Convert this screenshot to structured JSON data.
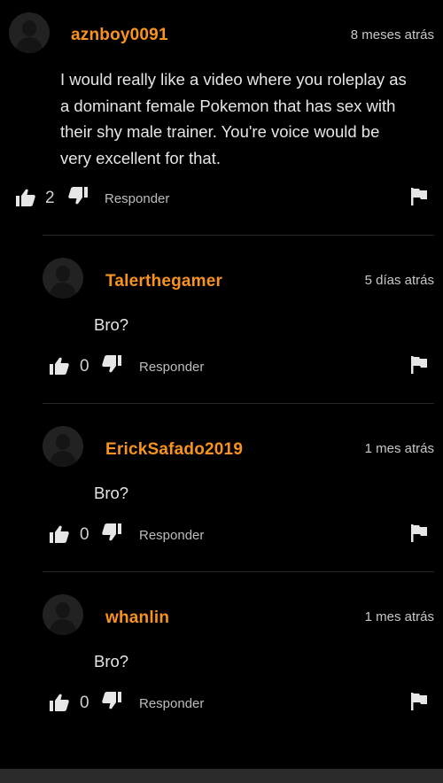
{
  "comments": [
    {
      "username": "aznboy0091",
      "time": "8 meses atrás",
      "lines": [
        "I would really like a video where you roleplay as",
        "a dominant female Pokemon that has sex with",
        "their shy male trainer. You're voice would be",
        "very excellent for that."
      ],
      "likes": "2",
      "reply_label": "Responder"
    },
    {
      "username": "Talerthegamer",
      "time": "5 días atrás",
      "lines": [
        "Bro?"
      ],
      "likes": "0",
      "reply_label": "Responder"
    },
    {
      "username": "ErickSafado2019",
      "time": "1 mes atrás",
      "lines": [
        "Bro?"
      ],
      "likes": "0",
      "reply_label": "Responder"
    },
    {
      "username": "whanlin",
      "time": "1 mes atrás",
      "lines": [
        "Bro?"
      ],
      "likes": "0",
      "reply_label": "Responder"
    }
  ],
  "bottom_bar": {
    "text": ""
  },
  "colors": {
    "background": "#000000",
    "username": "#f7931e",
    "text": "#e6e6e6",
    "muted": "#bcbcbc"
  },
  "icons": [
    "avatar-placeholder",
    "thumbs-up-icon",
    "thumbs-down-icon",
    "flag-icon"
  ]
}
